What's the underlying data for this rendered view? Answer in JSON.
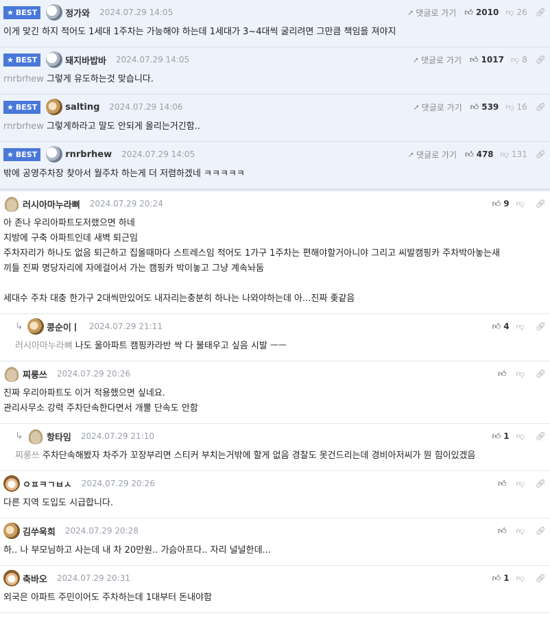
{
  "labels": {
    "best": "BEST",
    "reply": "댓글로 가기"
  },
  "best_comments": [
    {
      "nick": "정가와",
      "date": "2024.07.29 14:05",
      "up": "2010",
      "down": "26",
      "mention": "",
      "text": "이게 맞긴 하지 적어도 1세대 1주차는 가능해야 하는데 1세대가 3~4대씩 굴리려면 그만큼 책임을 져야지"
    },
    {
      "nick": "돼지바밥바",
      "date": "2024.07.29 14:05",
      "up": "1017",
      "down": "8",
      "mention": "rnrbrhew",
      "text": "그렇게 유도하는것 맞습니다."
    },
    {
      "nick": "salting",
      "date": "2024.07.29 14:06",
      "up": "539",
      "down": "16",
      "mention": "rnrbrhew",
      "text": "그렇게하라고 말도 안되게 올리는거긴함.."
    },
    {
      "nick": "rnrbrhew",
      "date": "2024.07.29 14:05",
      "up": "478",
      "down": "131",
      "mention": "",
      "text": "밖에 공영주차장 찾아서 월주차 하는게 더 저렴하겠네 ㅋㅋㅋㅋㅋ"
    }
  ],
  "comments": [
    {
      "nick": "러시아마누라뼈",
      "date": "2024.07.29 20:24",
      "up": "9",
      "mention": "",
      "lines": [
        "아 존나 우리아파트도저랬으면 하네",
        "지방에 구축 아파트인데 새벽 퇴근임",
        "주차자리가 하나도 없음 퇴근하고 집올때마다 스트레스임 적어도 1가구 1주차는 편해야할거아니야 그리고 씨발캠핑카 주차박아놓는새",
        "끼들 진짜 명당자리에 자에걸어서 가는 캠핑카 박이놓고 그냥 계속놔둠",
        "",
        "세대수 주차 대충 한가구 2대씩만있어도 내자리는충분히 하나는 나와야하는데 아...진짜 좆같음"
      ]
    },
    {
      "nick": "콩순이ㅣ",
      "date": "2024.07.29 21:11",
      "up": "4",
      "mention": "러시아마누라뼈",
      "lines": [
        "나도 울아파트 캠핑카라반 싹 다 불태우고 싶음 시발 ㅡㅡ"
      ]
    },
    {
      "nick": "찌룽쓰",
      "date": "2024.07.29 20:26",
      "up": "",
      "mention": "",
      "lines": [
        "진짜 우리아파트도 이거 적용했으면 싶네요.",
        "관리사무소 강력 주차단속한다면서 개뿔 단속도 안함"
      ]
    },
    {
      "nick": "항타임",
      "date": "2024.07.29 21:10",
      "up": "1",
      "mention": "찌룽쓰",
      "lines": [
        "주차단속해봤자 차주가 꼬장부리면 스티커 부치는거밖에 할게 없음 경찰도 못건드리는데 경비아저씨가 뭔 힘이있겠음"
      ]
    },
    {
      "nick": "ㅇㅍㅋㄱㅂㅅ",
      "date": "2024.07.29 20:26",
      "up": "",
      "mention": "",
      "lines": [
        "다른 지역 도입도 시급합니다."
      ]
    },
    {
      "nick": "김쑤욱희",
      "date": "2024.07.29 20:28",
      "up": "",
      "mention": "",
      "lines": [
        "하.. 나 부모님하고 사는데 내 차 20만원.. 가슴아프다.. 자리 널널한데..."
      ]
    },
    {
      "nick": "축바오",
      "date": "2024.07.29 20:31",
      "up": "1",
      "mention": "",
      "lines": [
        "외국은 아파트 주민이어도 주차하는데 1대부터 돈내야함"
      ]
    }
  ],
  "icons": {
    "best": "star-icon",
    "reply": "send-arrow-icon",
    "up": "thumbs-up-icon",
    "down": "thumbs-down-icon",
    "more": "share-link-icon"
  },
  "colors": {
    "best_bg": "#eef2fb",
    "badge": "#4a78d9"
  }
}
